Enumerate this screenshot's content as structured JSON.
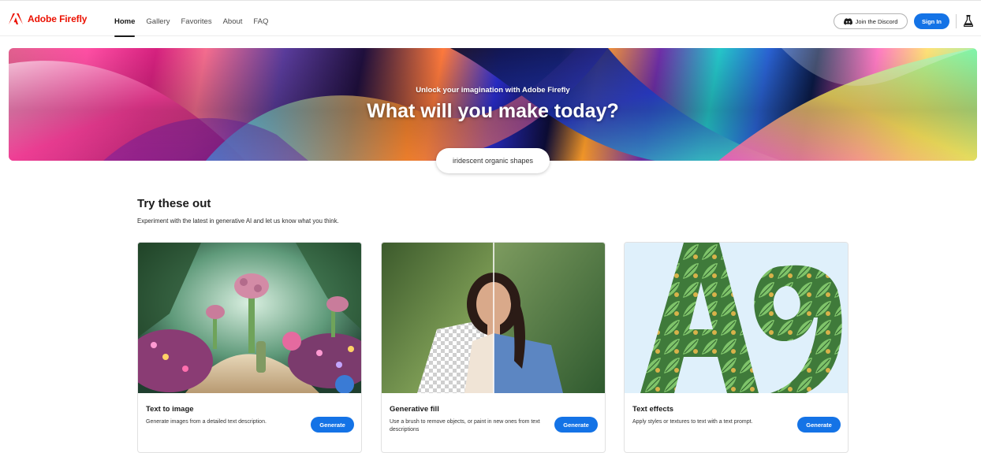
{
  "brand": {
    "name": "Adobe Firefly",
    "color": "#eb1000"
  },
  "nav": {
    "items": [
      {
        "label": "Home",
        "active": true
      },
      {
        "label": "Gallery",
        "active": false
      },
      {
        "label": "Favorites",
        "active": false
      },
      {
        "label": "About",
        "active": false
      },
      {
        "label": "FAQ",
        "active": false
      }
    ]
  },
  "header_actions": {
    "discord_label": "Join the Discord",
    "signin_label": "Sign In",
    "accent": "#1473e6"
  },
  "hero": {
    "subtitle": "Unlock your imagination with Adobe Firefly",
    "title": "What will you make today?",
    "prompt": "iridescent organic shapes"
  },
  "section": {
    "title": "Try these out",
    "description": "Experiment with the latest in generative AI and let us know what you think."
  },
  "cards": [
    {
      "title": "Text to image",
      "description": "Generate images from a detailed text description.",
      "button": "Generate"
    },
    {
      "title": "Generative fill",
      "description": "Use a brush to remove objects, or paint in new ones from text descriptions",
      "button": "Generate"
    },
    {
      "title": "Text effects",
      "description": "Apply styles or textures to text with a text prompt.",
      "button": "Generate"
    }
  ]
}
